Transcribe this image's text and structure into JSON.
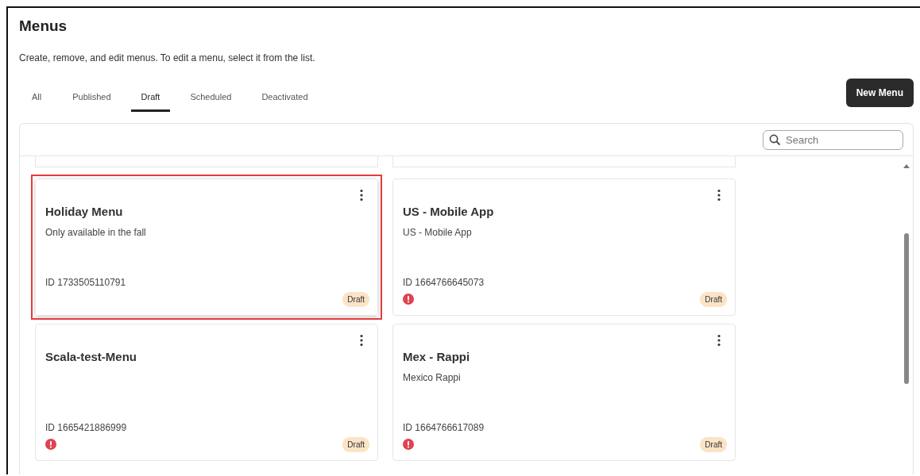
{
  "title": "Menus",
  "description": "Create, remove, and edit menus. To edit a menu, select it from the list.",
  "tabs": [
    {
      "label": "All",
      "selected": false
    },
    {
      "label": "Published",
      "selected": false
    },
    {
      "label": "Draft",
      "selected": true
    },
    {
      "label": "Scheduled",
      "selected": false
    },
    {
      "label": "Deactivated",
      "selected": false
    }
  ],
  "new_button": "New Menu",
  "search": {
    "placeholder": "Search"
  },
  "cards": [
    {
      "name": "Holiday Menu",
      "description": "Only available in the fall",
      "id": "ID 1733505110791",
      "warning": false,
      "status": "Draft",
      "highlighted": true
    },
    {
      "name": "US - Mobile App",
      "description": "US - Mobile App",
      "id": "ID 1664766645073",
      "warning": true,
      "status": "Draft",
      "highlighted": false
    },
    {
      "name": "Scala-test-Menu",
      "id": "ID 1665421886999",
      "warning": true,
      "status": "Draft",
      "highlighted": false
    },
    {
      "name": "Mex - Rappi",
      "description": "Mexico Rappi",
      "id": "ID 1664766617089",
      "warning": true,
      "status": "Draft",
      "highlighted": false
    }
  ]
}
